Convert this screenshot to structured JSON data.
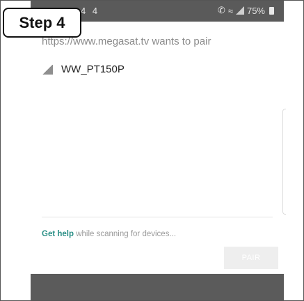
{
  "step_label": "Step 4",
  "status_bar": {
    "left_icons": "4 4",
    "battery_text": "75%"
  },
  "dialog": {
    "title": "https://www.megasat.tv wants to pair",
    "devices": [
      {
        "name": "WW_PT150P"
      }
    ],
    "help_link": "Get help",
    "help_text": " while scanning for devices...",
    "pair_label": "PAIR"
  },
  "colors": {
    "accent": "#2a8f86",
    "status_bar": "#5a5a5a",
    "nav_bar": "#5b5b5b"
  }
}
